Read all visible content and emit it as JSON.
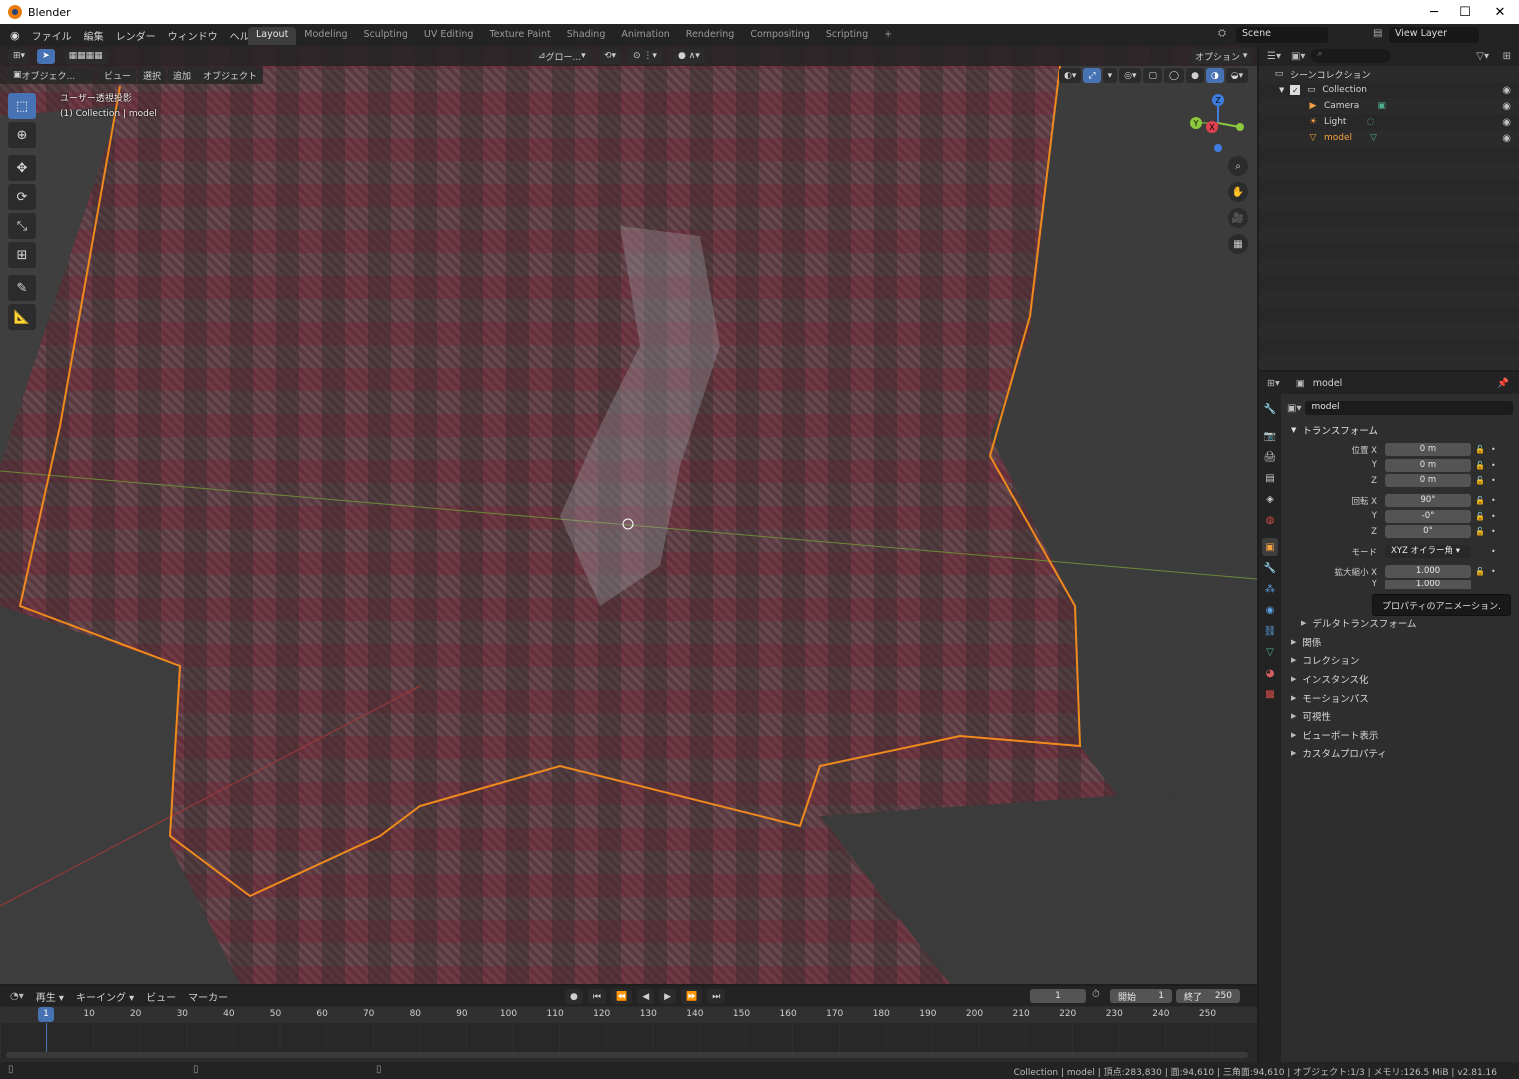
{
  "window": {
    "title": "Blender",
    "controls": [
      "─",
      "☐",
      "✕"
    ]
  },
  "topbar": {
    "menus": [
      "ファイル",
      "編集",
      "レンダー",
      "ウィンドウ",
      "ヘルプ"
    ],
    "workspaces": [
      "Layout",
      "Modeling",
      "Sculpting",
      "UV Editing",
      "Texture Paint",
      "Shading",
      "Animation",
      "Rendering",
      "Compositing",
      "Scripting",
      "+"
    ],
    "active_workspace": "Layout",
    "scene": "Scene",
    "view_layer": "View Layer"
  },
  "viewport": {
    "mode": "オブジェク...",
    "menus": [
      "ビュー",
      "選択",
      "追加",
      "オブジェクト"
    ],
    "orientation": "グロー...",
    "options": "オプション",
    "info_line1": "ユーザー透視投影",
    "info_line2": "(1) Collection | model",
    "tools": [
      "select-box-icon",
      "cursor-icon",
      "move-icon",
      "rotate-icon",
      "scale-icon",
      "transform-icon",
      "annotate-icon",
      "measure-icon"
    ],
    "nav_tools": [
      "zoom-icon",
      "pan-hand-icon",
      "camera-icon",
      "grid-ortho-icon"
    ],
    "gizmo_axes": [
      "Z",
      "Y",
      "X"
    ]
  },
  "outliner": {
    "root": "シーンコレクション",
    "items": [
      {
        "label": "Collection",
        "level": 1,
        "icon": "collection-icon"
      },
      {
        "label": "Camera",
        "level": 2,
        "icon": "camera-object-icon"
      },
      {
        "label": "Light",
        "level": 2,
        "icon": "light-object-icon"
      },
      {
        "label": "model",
        "level": 2,
        "icon": "mesh-object-icon",
        "selected": true
      }
    ]
  },
  "properties": {
    "object_name": "model",
    "name_field": "model",
    "transform_title": "トランスフォーム",
    "location": {
      "label": "位置 X",
      "x": "0 m",
      "y": "0 m",
      "z": "0 m"
    },
    "rotation": {
      "label": "回転 X",
      "x": "90°",
      "y": "-0°",
      "z": "0°"
    },
    "mode": {
      "label": "モード",
      "value": "XYZ オイラー角"
    },
    "scale": {
      "label": "拡大縮小 X",
      "x": "1.000",
      "y": "1.000"
    },
    "axis_y": "Y",
    "axis_z": "Z",
    "tooltip": "プロパティのアニメーション.",
    "delta_transform": "デルタトランスフォーム",
    "panels": [
      "関係",
      "コレクション",
      "インスタンス化",
      "モーションパス",
      "可視性",
      "ビューポート表示",
      "カスタムプロパティ"
    ]
  },
  "timeline": {
    "menus": [
      "再生",
      "キーイング",
      "ビュー",
      "マーカー"
    ],
    "current_frame": "1",
    "start_label": "開始",
    "start_value": "1",
    "end_label": "終了",
    "end_value": "250",
    "ticks": [
      "1",
      "10",
      "20",
      "30",
      "40",
      "50",
      "60",
      "70",
      "80",
      "90",
      "100",
      "110",
      "120",
      "130",
      "140",
      "150",
      "160",
      "170",
      "180",
      "190",
      "200",
      "210",
      "220",
      "230",
      "240",
      "250"
    ]
  },
  "statusbar": {
    "text": "Collection | model | 頂点:283,830 | 面:94,610 | 三角面:94,610 | オブジェクト:1/3 | メモリ:126.5 MiB | v2.81.16"
  },
  "colors": {
    "accent": "#4772b3",
    "selection": "#f5a142",
    "background": "#2e2e2e"
  }
}
